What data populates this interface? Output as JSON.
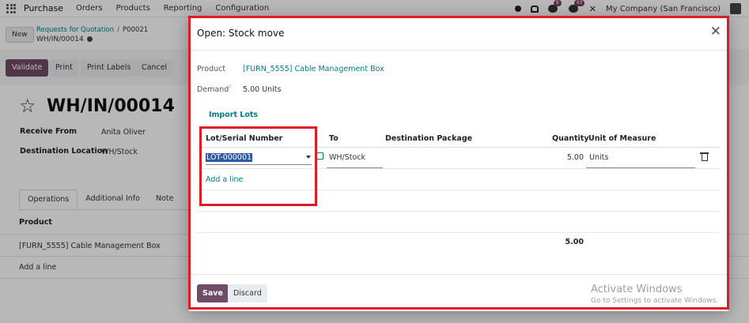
{
  "topnav": {
    "app_name": "Purchase",
    "menu": [
      "Orders",
      "Products",
      "Reporting",
      "Configuration"
    ],
    "chat_count": "9",
    "activity_count": "43",
    "company": "My Company (San Francisco)"
  },
  "control_panel": {
    "new_label": "New",
    "breadcrumb_parent": "Requests for Quotation",
    "breadcrumb_order": "P00021",
    "record_ref": "WH/IN/00014"
  },
  "actions": {
    "validate": "Validate",
    "print": "Print",
    "print_labels": "Print Labels",
    "cancel": "Cancel"
  },
  "record": {
    "title": "WH/IN/00014",
    "receive_from_label": "Receive From",
    "receive_from_value": "Anita Oliver",
    "dest_location_label": "Destination Location",
    "dest_location_value": "WH/Stock",
    "tabs": [
      "Operations",
      "Additional Info",
      "Note"
    ],
    "product_header": "Product",
    "product_row": "[FURN_5555] Cable Management Box",
    "add_line": "Add a line"
  },
  "modal": {
    "title": "Open: Stock move",
    "product_label": "Product",
    "product_value": "[FURN_5555] Cable Management Box",
    "demand_label": "Demand",
    "demand_help": "?",
    "demand_value": "5.00",
    "demand_uom": "Units",
    "import_lots": "Import Lots",
    "columns": {
      "lot": "Lot/Serial Number",
      "to": "To",
      "dest_package": "Destination Package",
      "quantity": "Quantity",
      "uom": "Unit of Measure"
    },
    "row": {
      "lot": "LOT-000001",
      "to": "WH/Stock",
      "quantity": "5.00",
      "uom": "Units"
    },
    "add_line": "Add a line",
    "total_quantity": "5.00",
    "save": "Save",
    "discard": "Discard"
  },
  "watermark": {
    "line1": "Activate Windows",
    "line2": "Go to Settings to activate Windows."
  },
  "colors": {
    "brand": "#714b67",
    "link": "#017e84",
    "highlight_box": "#e01b24"
  }
}
